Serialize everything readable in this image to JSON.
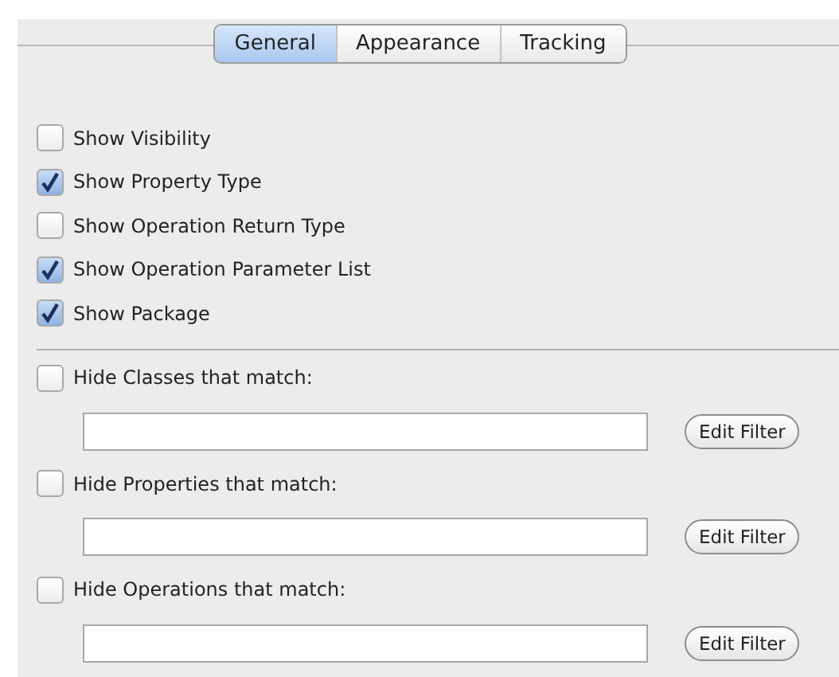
{
  "tabs": [
    {
      "label": "General",
      "selected": true
    },
    {
      "label": "Appearance",
      "selected": false
    },
    {
      "label": "Tracking",
      "selected": false
    }
  ],
  "options": [
    {
      "label": "Show Visibility",
      "checked": false
    },
    {
      "label": "Show Property Type",
      "checked": true
    },
    {
      "label": "Show Operation Return Type",
      "checked": false
    },
    {
      "label": "Show Operation Parameter List",
      "checked": true
    },
    {
      "label": "Show Package",
      "checked": true
    }
  ],
  "filters": [
    {
      "label": "Hide Classes that match:",
      "checked": false,
      "button": "Edit Filter"
    },
    {
      "label": "Hide Properties that match:",
      "checked": false,
      "button": "Edit Filter"
    },
    {
      "label": "Hide Operations that match:",
      "checked": false,
      "button": "Edit Filter"
    }
  ]
}
